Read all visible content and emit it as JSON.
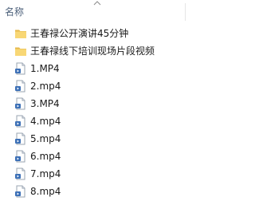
{
  "header": {
    "name_column": "名称"
  },
  "items": [
    {
      "name": "王春禄公开演讲45分钟",
      "type": "folder",
      "icon": "folder-icon"
    },
    {
      "name": "王春禄线下培训现场片段视频",
      "type": "folder",
      "icon": "folder-icon"
    },
    {
      "name": "1.MP4",
      "type": "video",
      "icon": "video-file-icon"
    },
    {
      "name": "2.mp4",
      "type": "video",
      "icon": "video-file-icon"
    },
    {
      "name": "3.MP4",
      "type": "video",
      "icon": "video-file-icon"
    },
    {
      "name": "4.mp4",
      "type": "video",
      "icon": "video-file-icon"
    },
    {
      "name": "5.mp4",
      "type": "video",
      "icon": "video-file-icon"
    },
    {
      "name": "6.mp4",
      "type": "video",
      "icon": "video-file-icon"
    },
    {
      "name": "7.mp4",
      "type": "video",
      "icon": "video-file-icon"
    },
    {
      "name": "8.mp4",
      "type": "video",
      "icon": "video-file-icon"
    }
  ],
  "colors": {
    "folder": "#f8d775",
    "folder_dark": "#e6b94c",
    "header_text": "#4c607a",
    "video_icon": "#3b6fb6"
  }
}
